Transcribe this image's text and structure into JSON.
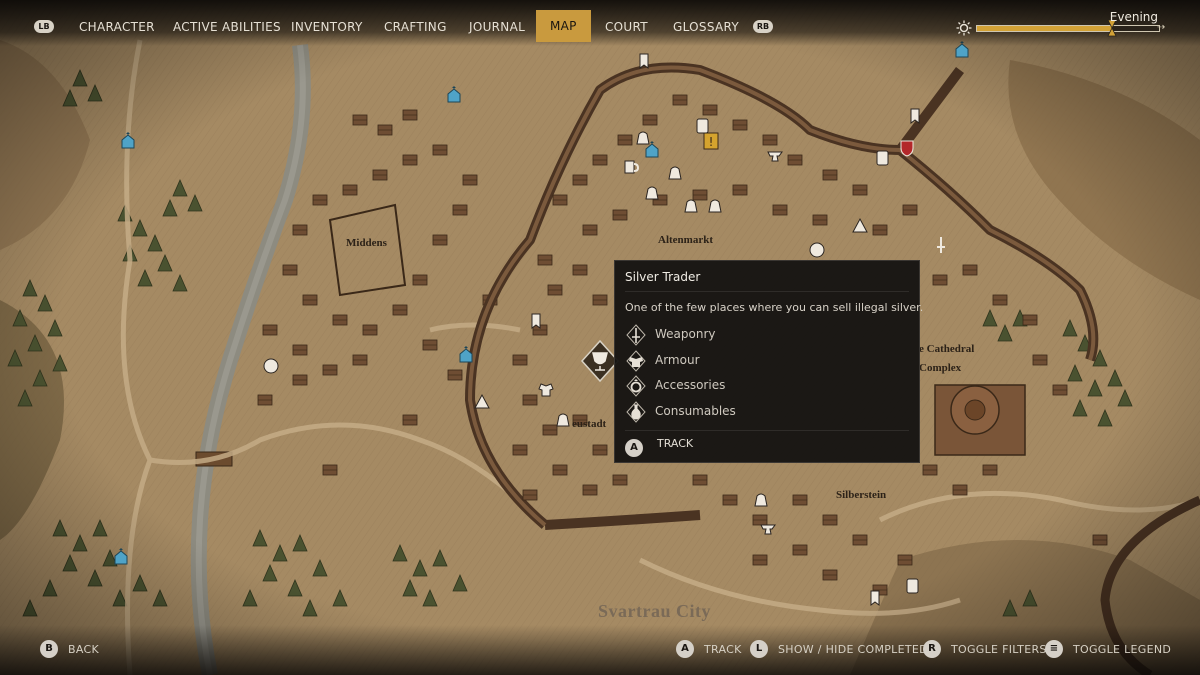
{
  "nav": {
    "left_bumper": "LB",
    "right_bumper": "RB",
    "tabs": [
      "CHARACTER",
      "ACTIVE ABILITIES",
      "INVENTORY",
      "CRAFTING",
      "JOURNAL",
      "MAP",
      "COURT",
      "GLOSSARY"
    ],
    "active_tab": "MAP"
  },
  "time_of_day": {
    "label": "Evening",
    "progress": 0.74
  },
  "map": {
    "labels": {
      "middens": "Middens",
      "altenmarkt": "Altenmarkt",
      "cathedral_line1": "e Cathedral",
      "cathedral_line2": "Complex",
      "neustadt": "eustadt",
      "silberstein": "Silberstein",
      "city": "Svartrau City"
    }
  },
  "tooltip": {
    "title": "Silver Trader",
    "description": "One of the few places where you can sell illegal silver.",
    "services": [
      {
        "icon": "sword-icon",
        "label": "Weaponry"
      },
      {
        "icon": "armour-icon",
        "label": "Armour"
      },
      {
        "icon": "ring-icon",
        "label": "Accessories"
      },
      {
        "icon": "potion-icon",
        "label": "Consumables"
      }
    ],
    "action_button": "A",
    "action_label": "TRACK"
  },
  "footer": {
    "back": {
      "button": "B",
      "label": "BACK"
    },
    "track": {
      "button": "A",
      "label": "TRACK"
    },
    "show_hide": {
      "button": "L",
      "label": "SHOW / HIDE COMPLETED"
    },
    "filters": {
      "button": "R",
      "label": "TOGGLE FILTERS"
    },
    "legend": {
      "button": "≡",
      "label": "TOGGLE LEGEND"
    }
  },
  "colors": {
    "accent": "#c99a3e",
    "parchment": "#a88b62",
    "forest": "#4c5232",
    "river": "#8a8a82",
    "buildings": "#6e4d33",
    "tooltip_bg": "#121110",
    "church_pin": "#4fa3c7"
  }
}
